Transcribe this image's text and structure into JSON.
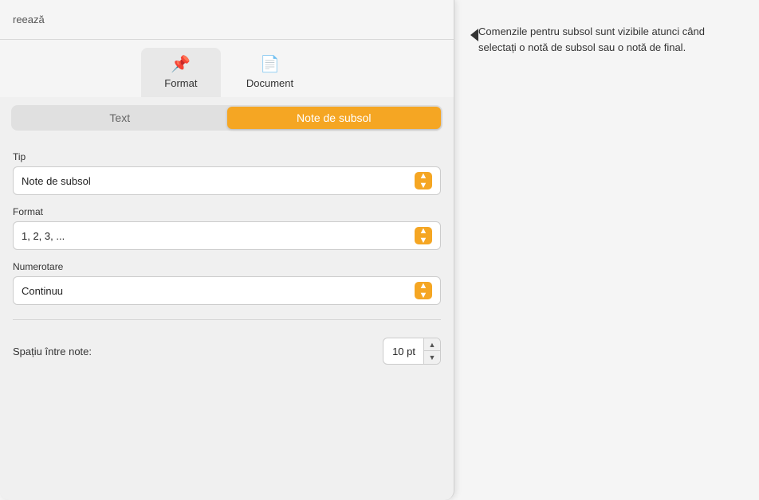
{
  "topbar": {
    "partial_text": "reează"
  },
  "tabs": [
    {
      "id": "format",
      "icon": "📌",
      "label": "Format",
      "active": true
    },
    {
      "id": "document",
      "icon": "📄",
      "label": "Document",
      "active": false
    }
  ],
  "segments": [
    {
      "id": "text",
      "label": "Text",
      "active": false
    },
    {
      "id": "note-de-subsol",
      "label": "Note de subsol",
      "active": true
    }
  ],
  "fields": [
    {
      "id": "tip",
      "label": "Tip",
      "value": "Note de subsol"
    },
    {
      "id": "format",
      "label": "Format",
      "value": "1, 2, 3, ..."
    },
    {
      "id": "numerotare",
      "label": "Numerotare",
      "value": "Continuu"
    }
  ],
  "spacing": {
    "label": "Spațiu între note:",
    "value": "10 pt"
  },
  "callout": {
    "text": "Comenzile pentru subsol sunt vizibile atunci când selectați o notă de subsol sau o notă de final."
  }
}
